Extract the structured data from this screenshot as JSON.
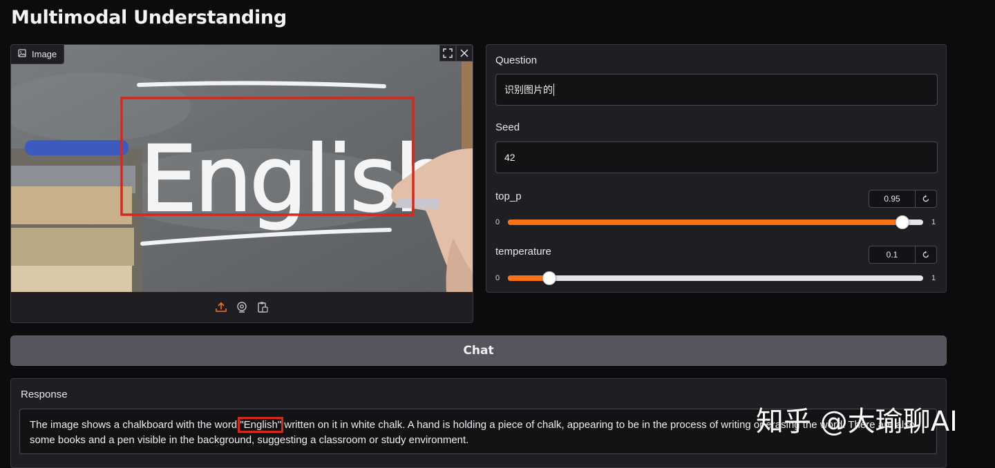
{
  "page": {
    "title": "Multimodal Understanding"
  },
  "image_panel": {
    "label": "Image",
    "photo_text": "English",
    "tools": [
      "fullscreen-icon",
      "close-icon"
    ],
    "source_buttons": [
      "upload-icon",
      "webcam-icon",
      "clipboard-icon"
    ],
    "accent": "#f97316"
  },
  "question": {
    "label": "Question",
    "value": "识别图片的"
  },
  "seed": {
    "label": "Seed",
    "value": "42"
  },
  "top_p": {
    "label": "top_p",
    "value": "0.95",
    "min": "0",
    "max": "1",
    "fraction": 0.95
  },
  "temperature": {
    "label": "temperature",
    "value": "0.1",
    "min": "0",
    "max": "1",
    "fraction": 0.1
  },
  "chat": {
    "label": "Chat"
  },
  "response": {
    "label": "Response",
    "text_before": "The image shows a chalkboard with the word ",
    "highlight": "\"English\"",
    "text_after": " written on it in white chalk. A hand is holding a piece of chalk, appearing to be in the process of writing or erasing the word. There are also some books and a pen visible in the background, suggesting a classroom or study environment."
  },
  "watermark": {
    "text": "知乎 @大瑜聊AI"
  },
  "colors": {
    "slider_fill": "#f97316",
    "highlight_box": "#d8281c",
    "background": "#0c0c0f"
  }
}
